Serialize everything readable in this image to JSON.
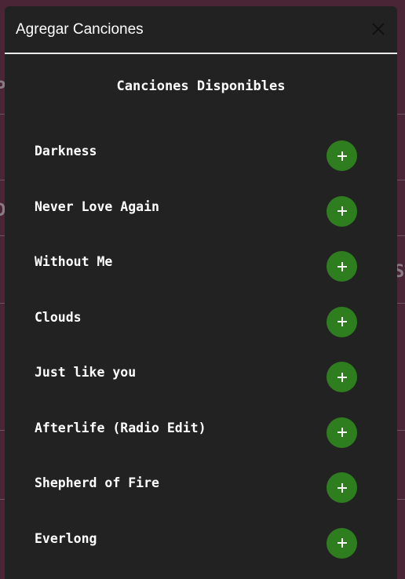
{
  "modal": {
    "title": "Agregar Canciones",
    "close_icon": "close-icon"
  },
  "section": {
    "title": "Canciones Disponibles"
  },
  "songs": [
    {
      "title": "Darkness",
      "action_icon": "plus-icon"
    },
    {
      "title": "Never Love Again",
      "action_icon": "plus-icon"
    },
    {
      "title": "Without Me",
      "action_icon": "plus-icon"
    },
    {
      "title": "Clouds",
      "action_icon": "plus-icon"
    },
    {
      "title": "Just like you",
      "action_icon": "plus-icon"
    },
    {
      "title": "Afterlife (Radio Edit)",
      "action_icon": "plus-icon"
    },
    {
      "title": "Shepherd of Fire",
      "action_icon": "plus-icon"
    },
    {
      "title": "Everlong",
      "action_icon": "plus-icon"
    }
  ],
  "colors": {
    "backdrop": "#4a2535",
    "modal_bg": "#222222",
    "add_button": "#2e7d1e",
    "text": "#ffffff"
  }
}
